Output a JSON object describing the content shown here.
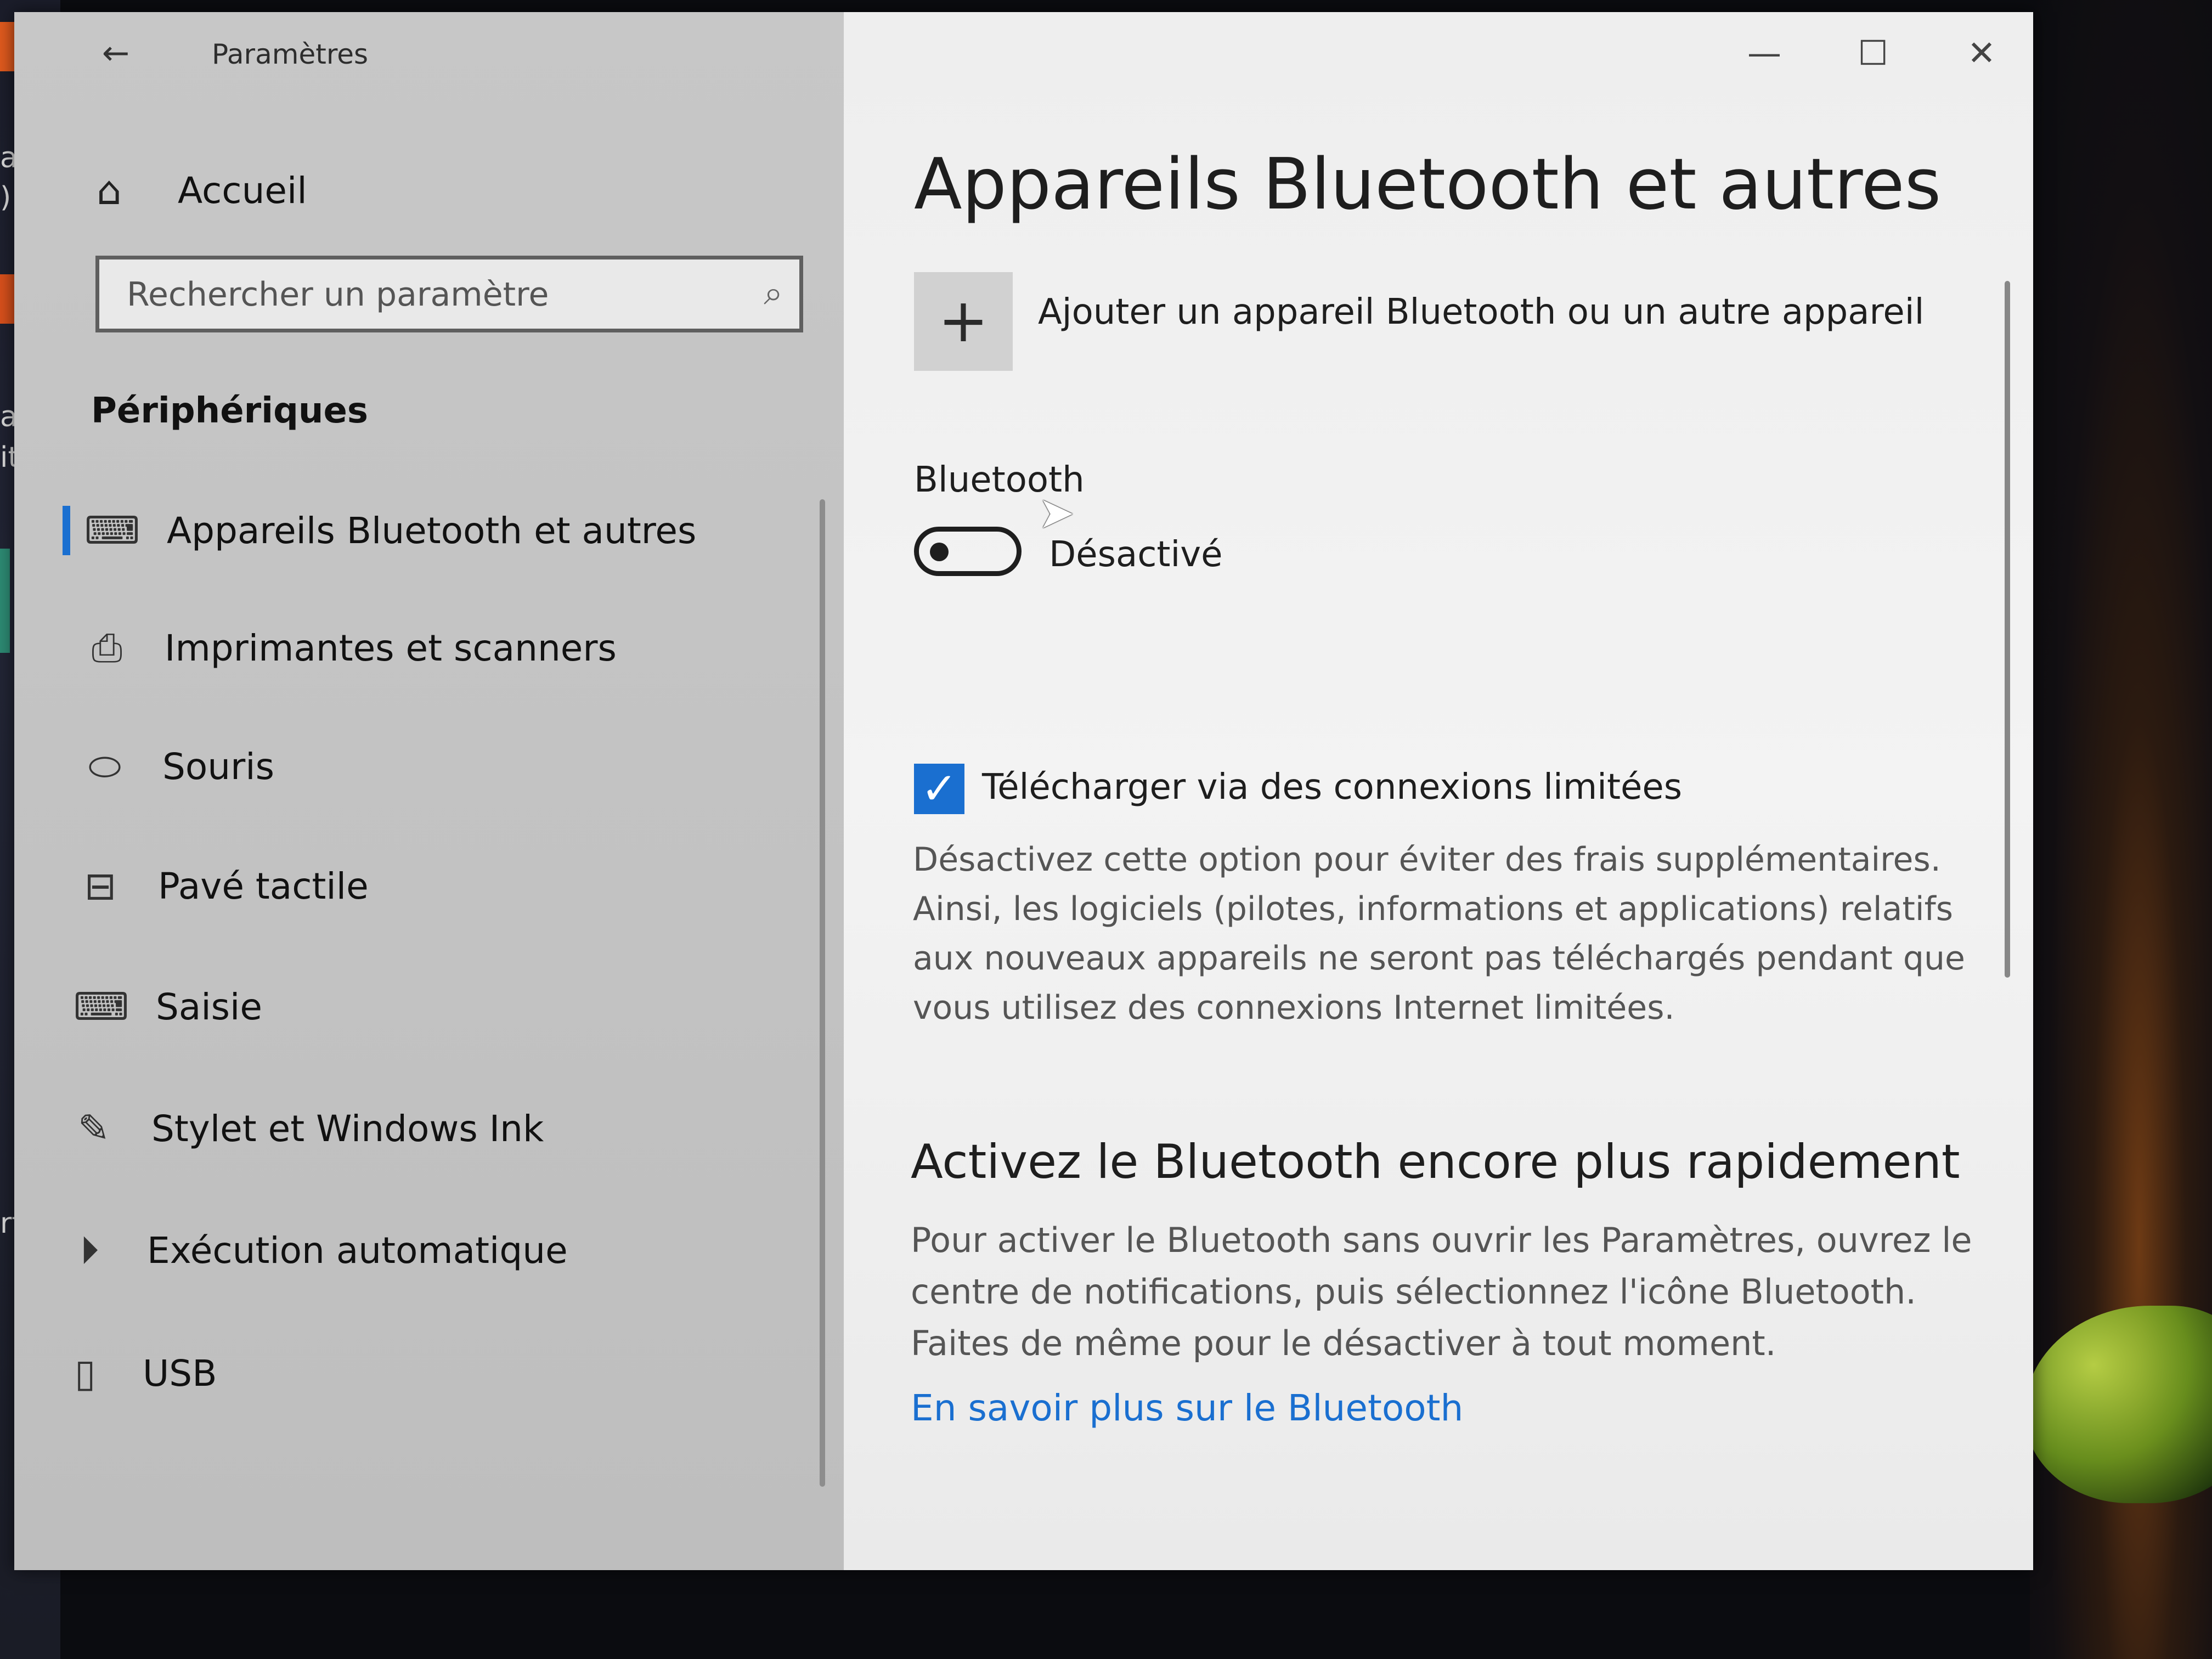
{
  "background": {
    "left_text_1": "acke",
    "left_text_2": ")",
    "left_text_3": "acke",
    "left_text_4": "it)",
    "left_text_5": "rt"
  },
  "window": {
    "title": "Paramètres",
    "back_glyph": "←",
    "controls": {
      "minimize": "—",
      "maximize": "☐",
      "close": "✕"
    }
  },
  "sidebar": {
    "home": {
      "icon": "home-icon",
      "glyph": "⌂",
      "label": "Accueil"
    },
    "search": {
      "placeholder": "Rechercher un paramètre",
      "icon": "search-icon",
      "glyph": "⌕"
    },
    "section_title": "Périphériques",
    "items": [
      {
        "label": "Appareils Bluetooth et autres",
        "icon": "bluetooth-devices-icon",
        "glyph": "⌨",
        "active": true
      },
      {
        "label": "Imprimantes et scanners",
        "icon": "printer-icon",
        "glyph": "⎙"
      },
      {
        "label": "Souris",
        "icon": "mouse-icon",
        "glyph": "⬭"
      },
      {
        "label": "Pavé tactile",
        "icon": "touchpad-icon",
        "glyph": "⊟"
      },
      {
        "label": "Saisie",
        "icon": "keyboard-icon",
        "glyph": "⌨"
      },
      {
        "label": "Stylet et Windows Ink",
        "icon": "pen-icon",
        "glyph": "✎"
      },
      {
        "label": "Exécution automatique",
        "icon": "autoplay-icon",
        "glyph": "⏵"
      },
      {
        "label": "USB",
        "icon": "usb-icon",
        "glyph": "▯"
      }
    ]
  },
  "main": {
    "title": "Appareils Bluetooth et autres",
    "add_device": {
      "glyph": "+",
      "label": "Ajouter un appareil Bluetooth ou un autre appareil"
    },
    "bluetooth": {
      "label": "Bluetooth",
      "toggle_state": "Désactivé",
      "on": false
    },
    "metered": {
      "checked": true,
      "check_glyph": "✓",
      "label": "Télécharger via des connexions limitées",
      "description": "Désactivez cette option pour éviter des frais supplémentaires. Ainsi, les logiciels (pilotes, informations et applications) relatifs aux nouveaux appareils ne seront pas téléchargés pendant que vous utilisez des connexions Internet limitées."
    },
    "quick": {
      "heading": "Activez le Bluetooth encore plus rapidement",
      "description": "Pour activer le Bluetooth sans ouvrir les Paramètres, ouvrez le centre de notifications, puis sélectionnez l'icône Bluetooth. Faites de même pour le désactiver à tout moment.",
      "link": "En savoir plus sur le Bluetooth"
    }
  },
  "colors": {
    "accent": "#1a6fd0",
    "sidebar_bg": "#c4c4c4",
    "main_bg": "#eeeeee"
  }
}
